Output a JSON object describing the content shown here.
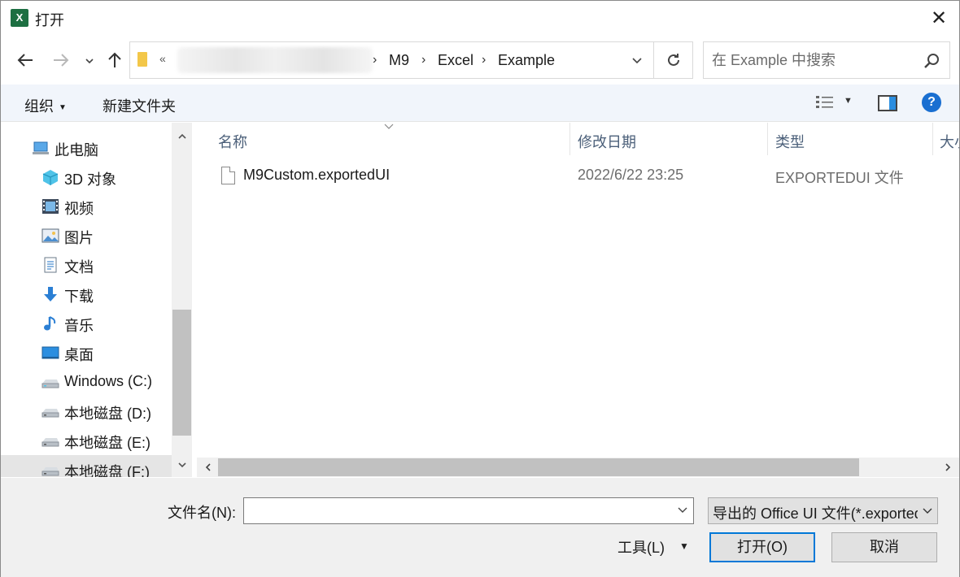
{
  "window": {
    "title": "打开",
    "app_icon_letter": "X"
  },
  "address": {
    "overflow": "«",
    "crumbs": [
      "M9",
      "Excel",
      "Example"
    ],
    "separator": "›"
  },
  "search": {
    "placeholder": "在 Example 中搜索"
  },
  "commandbar": {
    "organize": "组织",
    "new_folder": "新建文件夹",
    "help": "?"
  },
  "nav": {
    "items": [
      {
        "label": "此电脑",
        "icon": "computer-icon"
      },
      {
        "label": "3D 对象",
        "icon": "cube-3d-icon"
      },
      {
        "label": "视频",
        "icon": "video-icon"
      },
      {
        "label": "图片",
        "icon": "pictures-icon"
      },
      {
        "label": "文档",
        "icon": "documents-icon"
      },
      {
        "label": "下载",
        "icon": "download-icon"
      },
      {
        "label": "音乐",
        "icon": "music-icon"
      },
      {
        "label": "桌面",
        "icon": "desktop-icon"
      },
      {
        "label": "Windows (C:)",
        "icon": "drive-icon"
      },
      {
        "label": "本地磁盘 (D:)",
        "icon": "drive-icon"
      },
      {
        "label": "本地磁盘 (E:)",
        "icon": "drive-icon"
      },
      {
        "label": "本地磁盘 (F:)",
        "icon": "drive-icon"
      }
    ],
    "selected_index": 11
  },
  "filelist": {
    "columns": [
      "名称",
      "修改日期",
      "类型",
      "大小"
    ],
    "rows": [
      {
        "name": "M9Custom.exportedUI",
        "modified": "2022/6/22 23:25",
        "type": "EXPORTEDUI 文件"
      }
    ]
  },
  "bottom": {
    "filename_label": "文件名(N):",
    "filename_value": "",
    "filetype_value": "导出的 Office UI 文件(*.exportedUI)",
    "tools_label": "工具(L)",
    "open_label": "打开(O)",
    "cancel_label": "取消"
  },
  "colors": {
    "accent": "#0078d7",
    "excel_green": "#1d6f42",
    "header_text": "#4c607a"
  }
}
